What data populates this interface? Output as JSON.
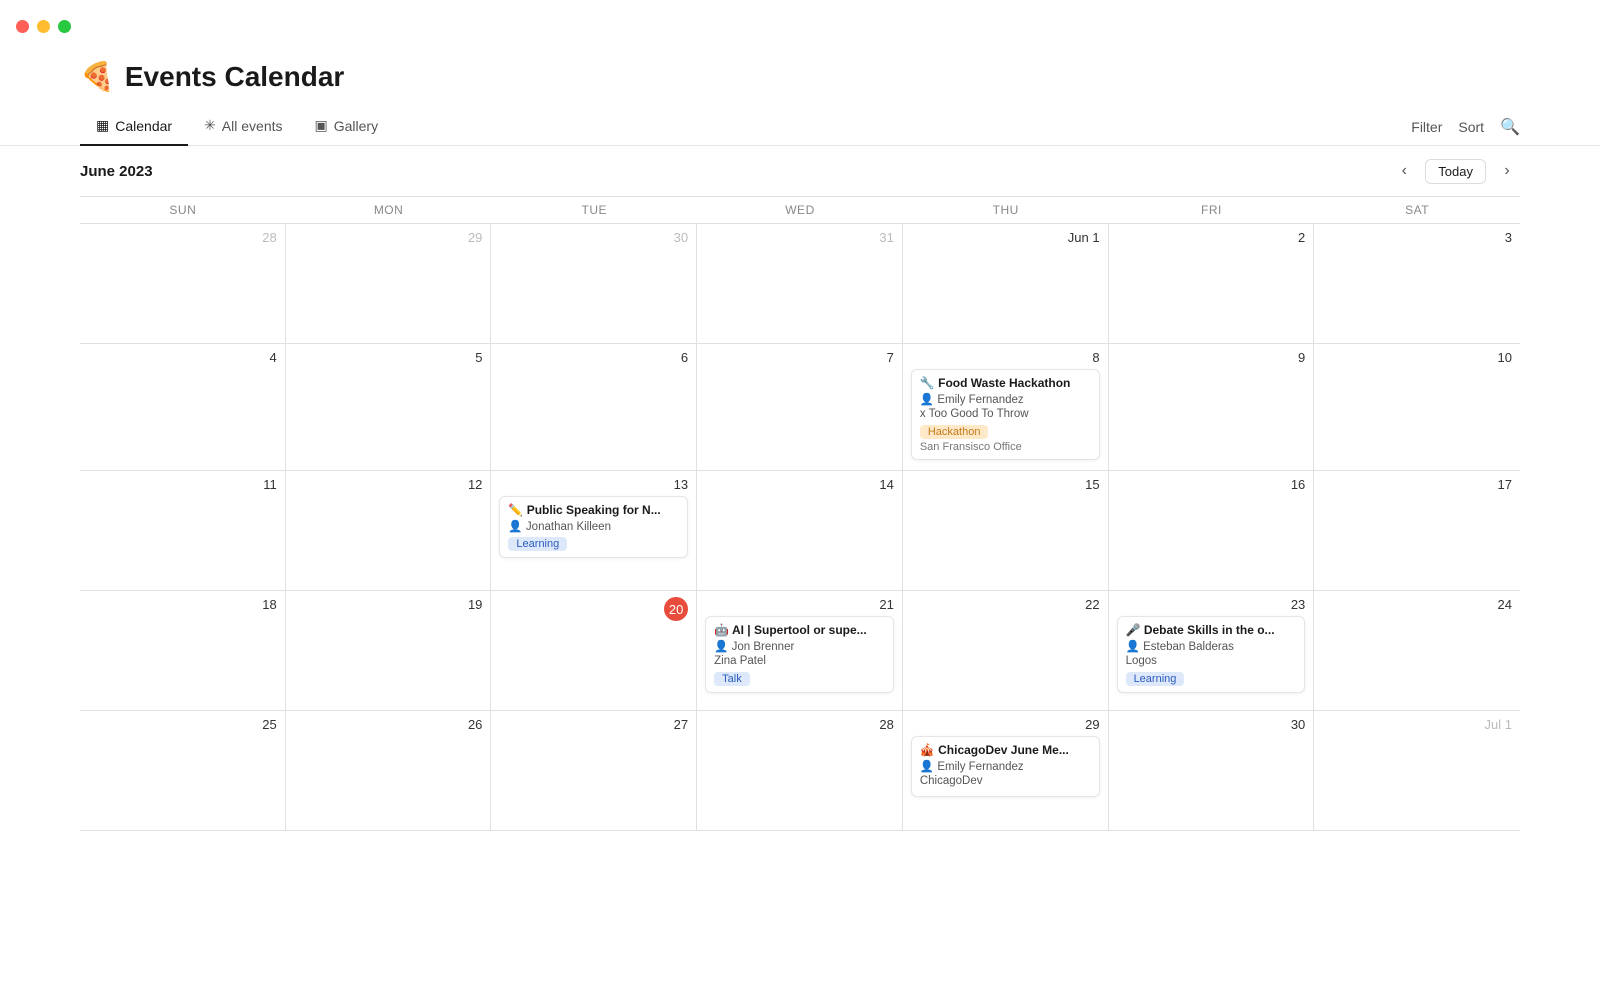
{
  "app": {
    "icon": "🍕",
    "title": "Events Calendar"
  },
  "titlebar": {
    "traffic_lights": [
      "red",
      "yellow",
      "green"
    ]
  },
  "tabs": {
    "items": [
      {
        "id": "calendar",
        "icon": "▦",
        "label": "Calendar",
        "active": true
      },
      {
        "id": "all-events",
        "icon": "✳",
        "label": "All events",
        "active": false
      },
      {
        "id": "gallery",
        "icon": "▣",
        "label": "Gallery",
        "active": false
      }
    ],
    "actions": {
      "filter": "Filter",
      "sort": "Sort"
    }
  },
  "calendar": {
    "month_title": "June 2023",
    "today_label": "Today",
    "day_headers": [
      "Sun",
      "Mon",
      "Tue",
      "Wed",
      "Thu",
      "Fri",
      "Sat"
    ],
    "weeks": [
      {
        "days": [
          {
            "num": "28",
            "other_month": true,
            "today": false,
            "events": []
          },
          {
            "num": "29",
            "other_month": true,
            "today": false,
            "events": []
          },
          {
            "num": "30",
            "other_month": true,
            "today": false,
            "events": []
          },
          {
            "num": "31",
            "other_month": true,
            "today": false,
            "events": []
          },
          {
            "num": "Jun 1",
            "other_month": false,
            "today": false,
            "events": []
          },
          {
            "num": "2",
            "other_month": false,
            "today": false,
            "events": []
          },
          {
            "num": "3",
            "other_month": false,
            "today": false,
            "events": []
          }
        ]
      },
      {
        "days": [
          {
            "num": "4",
            "other_month": false,
            "today": false,
            "events": []
          },
          {
            "num": "5",
            "other_month": false,
            "today": false,
            "events": []
          },
          {
            "num": "6",
            "other_month": false,
            "today": false,
            "events": []
          },
          {
            "num": "7",
            "other_month": false,
            "today": false,
            "events": []
          },
          {
            "num": "8",
            "other_month": false,
            "today": false,
            "events": [
              {
                "id": "food-waste-hackathon",
                "icon": "🔧",
                "title": "Food Waste Hackathon",
                "host_icon": "👤",
                "host": "Emily Fernandez",
                "org": "x Too Good To Throw",
                "tag": "Hackathon",
                "tag_class": "tag-hackathon",
                "location": "San Fransisco Office"
              }
            ]
          },
          {
            "num": "9",
            "other_month": false,
            "today": false,
            "events": []
          },
          {
            "num": "10",
            "other_month": false,
            "today": false,
            "events": []
          }
        ]
      },
      {
        "days": [
          {
            "num": "11",
            "other_month": false,
            "today": false,
            "events": []
          },
          {
            "num": "12",
            "other_month": false,
            "today": false,
            "events": []
          },
          {
            "num": "13",
            "other_month": false,
            "today": false,
            "events": [
              {
                "id": "public-speaking",
                "icon": "✏️",
                "title": "Public Speaking for N...",
                "host_icon": "👤",
                "host": "Jonathan Killeen",
                "org": "",
                "tag": "Learning",
                "tag_class": "tag-learning",
                "location": ""
              }
            ]
          },
          {
            "num": "14",
            "other_month": false,
            "today": false,
            "events": []
          },
          {
            "num": "15",
            "other_month": false,
            "today": false,
            "events": []
          },
          {
            "num": "16",
            "other_month": false,
            "today": false,
            "events": []
          },
          {
            "num": "17",
            "other_month": false,
            "today": false,
            "events": []
          }
        ]
      },
      {
        "days": [
          {
            "num": "18",
            "other_month": false,
            "today": false,
            "events": []
          },
          {
            "num": "19",
            "other_month": false,
            "today": false,
            "events": []
          },
          {
            "num": "20",
            "other_month": false,
            "today": true,
            "events": []
          },
          {
            "num": "21",
            "other_month": false,
            "today": false,
            "events": [
              {
                "id": "ai-supertool",
                "icon": "🤖",
                "title": "AI | Supertool or supe...",
                "host_icon": "👤",
                "host": "Jon Brenner",
                "org": "Zina Patel",
                "tag": "Talk",
                "tag_class": "tag-talk",
                "location": ""
              }
            ]
          },
          {
            "num": "22",
            "other_month": false,
            "today": false,
            "events": []
          },
          {
            "num": "23",
            "other_month": false,
            "today": false,
            "events": [
              {
                "id": "debate-skills",
                "icon": "🎤",
                "title": "Debate Skills in the o...",
                "host_icon": "👤",
                "host": "Esteban Balderas",
                "org": "Logos",
                "tag": "Learning",
                "tag_class": "tag-learning",
                "location": ""
              }
            ]
          },
          {
            "num": "24",
            "other_month": false,
            "today": false,
            "events": []
          }
        ]
      },
      {
        "days": [
          {
            "num": "25",
            "other_month": false,
            "today": false,
            "events": []
          },
          {
            "num": "26",
            "other_month": false,
            "today": false,
            "events": []
          },
          {
            "num": "27",
            "other_month": false,
            "today": false,
            "events": []
          },
          {
            "num": "28",
            "other_month": false,
            "today": false,
            "events": []
          },
          {
            "num": "29",
            "other_month": false,
            "today": false,
            "events": [
              {
                "id": "chicagodev",
                "icon": "🎪",
                "title": "ChicagoDev June Me...",
                "host_icon": "👤",
                "host": "Emily Fernandez",
                "org": "ChicagoDev",
                "tag": "",
                "tag_class": "",
                "location": ""
              }
            ]
          },
          {
            "num": "30",
            "other_month": false,
            "today": false,
            "events": []
          },
          {
            "num": "Jul 1",
            "other_month": true,
            "today": false,
            "events": []
          }
        ]
      }
    ]
  }
}
